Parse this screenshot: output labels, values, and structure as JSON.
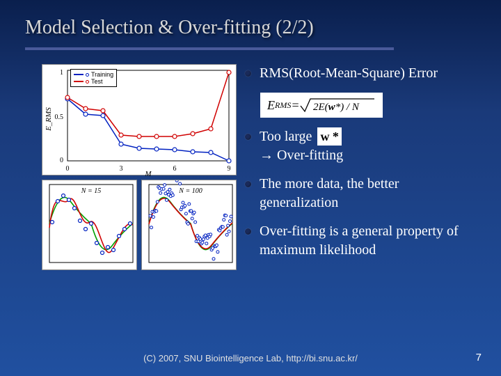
{
  "title": "Model Selection & Over-fitting (2/2)",
  "bullets": [
    {
      "text": "RMS(Root-Mean-Square) Error"
    },
    {
      "text_pre": "Too large ",
      "text_post": " → Over-fitting",
      "wstar": "w *"
    },
    {
      "text": "The more data, the better generalization"
    },
    {
      "text": "Over-fitting is a general property of maximum likelihood"
    }
  ],
  "formula": {
    "lhs": "E",
    "sub": "RMS",
    "eq": " = ",
    "inner": "2E(w*) / N"
  },
  "footer": "(C) 2007, SNU Biointelligence Lab, http://bi.snu.ac.kr/",
  "page": "7",
  "chart_data": [
    {
      "type": "line",
      "title": "",
      "xlabel": "M",
      "ylabel": "E_RMS",
      "xlim": [
        0,
        9
      ],
      "ylim": [
        0,
        1
      ],
      "xticks": [
        0,
        3,
        6,
        9
      ],
      "yticks": [
        0,
        0.5,
        1
      ],
      "legend": [
        "Training",
        "Test"
      ],
      "series": [
        {
          "name": "Training",
          "color": "blue",
          "x": [
            0,
            1,
            2,
            3,
            4,
            5,
            6,
            7,
            8,
            9
          ],
          "y": [
            0.68,
            0.52,
            0.5,
            0.18,
            0.14,
            0.13,
            0.12,
            0.1,
            0.09,
            0.0
          ]
        },
        {
          "name": "Test",
          "color": "red",
          "x": [
            0,
            1,
            2,
            3,
            4,
            5,
            6,
            7,
            8,
            9
          ],
          "y": [
            0.7,
            0.58,
            0.55,
            0.28,
            0.27,
            0.27,
            0.27,
            0.3,
            0.35,
            0.98
          ]
        }
      ]
    },
    {
      "type": "line",
      "title": "N = 15",
      "xlabel": "",
      "ylabel": "",
      "xlim": [
        0,
        1
      ],
      "ylim": [
        -1.2,
        1.2
      ],
      "series": [
        {
          "name": "true",
          "color": "green",
          "kind": "sin",
          "cycles": 1
        },
        {
          "name": "fit",
          "color": "red",
          "kind": "wiggly_sin"
        },
        {
          "name": "data",
          "color": "blue",
          "kind": "scatter",
          "n": 15
        }
      ]
    },
    {
      "type": "line",
      "title": "N = 100",
      "xlabel": "",
      "ylabel": "",
      "xlim": [
        0,
        1
      ],
      "ylim": [
        -1.2,
        1.2
      ],
      "series": [
        {
          "name": "true",
          "color": "green",
          "kind": "sin",
          "cycles": 1
        },
        {
          "name": "fit",
          "color": "red",
          "kind": "sin_close"
        },
        {
          "name": "data",
          "color": "blue",
          "kind": "scatter",
          "n": 100
        }
      ]
    }
  ]
}
